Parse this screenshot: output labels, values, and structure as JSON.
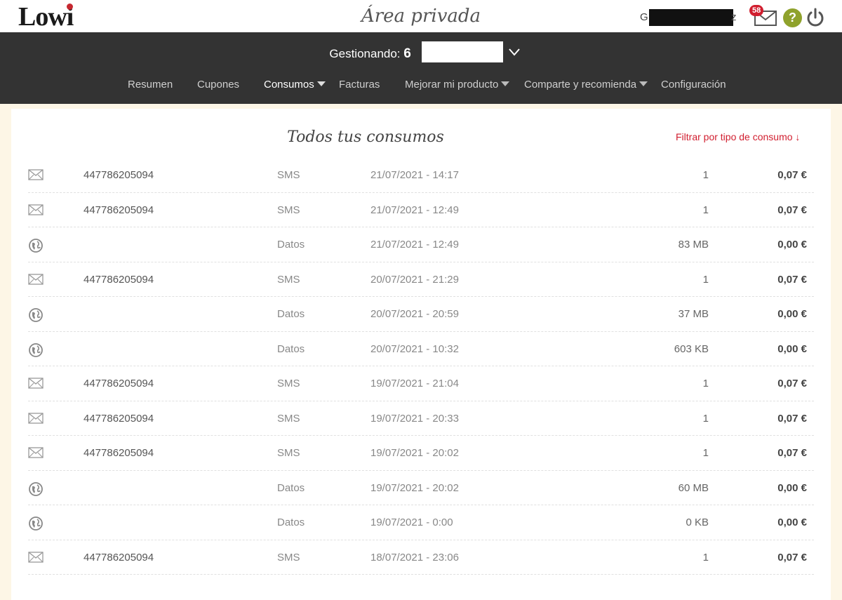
{
  "header": {
    "logo": "Lowi",
    "title": "Área privada",
    "user_initial": "G",
    "user_tail": "z",
    "mail_badge": "58",
    "help": "?"
  },
  "nav": {
    "managing_label": "Gestionando:",
    "managing_number": "6",
    "menu": [
      {
        "label": "Resumen",
        "dropdown": false,
        "active": false
      },
      {
        "label": "Cupones",
        "dropdown": false,
        "active": false
      },
      {
        "label": "Consumos",
        "dropdown": true,
        "active": true
      },
      {
        "label": "Facturas",
        "dropdown": false,
        "active": false
      },
      {
        "label": "Mejorar mi producto",
        "dropdown": true,
        "active": false
      },
      {
        "label": "Comparte y recomienda",
        "dropdown": true,
        "active": false
      },
      {
        "label": "Configuración",
        "dropdown": false,
        "active": false
      }
    ]
  },
  "consumos": {
    "title": "Todos tus consumos",
    "filter_label": "Filtrar por tipo de consumo ↓",
    "rows": [
      {
        "icon": "envelope-icon",
        "number": "447786205094",
        "type": "SMS",
        "date": "21/07/2021 - 14:17",
        "qty": "1",
        "cost": "0,07 €"
      },
      {
        "icon": "envelope-icon",
        "number": "447786205094",
        "type": "SMS",
        "date": "21/07/2021 - 12:49",
        "qty": "1",
        "cost": "0,07 €"
      },
      {
        "icon": "globe-icon",
        "number": "",
        "type": "Datos",
        "date": "21/07/2021 - 12:49",
        "qty": "83 MB",
        "cost": "0,00 €"
      },
      {
        "icon": "envelope-icon",
        "number": "447786205094",
        "type": "SMS",
        "date": "20/07/2021 - 21:29",
        "qty": "1",
        "cost": "0,07 €"
      },
      {
        "icon": "globe-icon",
        "number": "",
        "type": "Datos",
        "date": "20/07/2021 - 20:59",
        "qty": "37 MB",
        "cost": "0,00 €"
      },
      {
        "icon": "globe-icon",
        "number": "",
        "type": "Datos",
        "date": "20/07/2021 - 10:32",
        "qty": "603 KB",
        "cost": "0,00 €"
      },
      {
        "icon": "envelope-icon",
        "number": "447786205094",
        "type": "SMS",
        "date": "19/07/2021 - 21:04",
        "qty": "1",
        "cost": "0,07 €"
      },
      {
        "icon": "envelope-icon",
        "number": "447786205094",
        "type": "SMS",
        "date": "19/07/2021 - 20:33",
        "qty": "1",
        "cost": "0,07 €"
      },
      {
        "icon": "envelope-icon",
        "number": "447786205094",
        "type": "SMS",
        "date": "19/07/2021 - 20:02",
        "qty": "1",
        "cost": "0,07 €"
      },
      {
        "icon": "globe-icon",
        "number": "",
        "type": "Datos",
        "date": "19/07/2021 - 20:02",
        "qty": "60 MB",
        "cost": "0,00 €"
      },
      {
        "icon": "globe-icon",
        "number": "",
        "type": "Datos",
        "date": "19/07/2021 - 0:00",
        "qty": "0 KB",
        "cost": "0,00 €"
      },
      {
        "icon": "envelope-icon",
        "number": "447786205094",
        "type": "SMS",
        "date": "18/07/2021 - 23:06",
        "qty": "1",
        "cost": "0,07 €"
      }
    ]
  },
  "colors": {
    "accent_red": "#d11e2f",
    "nav_bg": "#333333",
    "help_green": "#8fa22c",
    "page_bg": "#fdf6e6"
  }
}
